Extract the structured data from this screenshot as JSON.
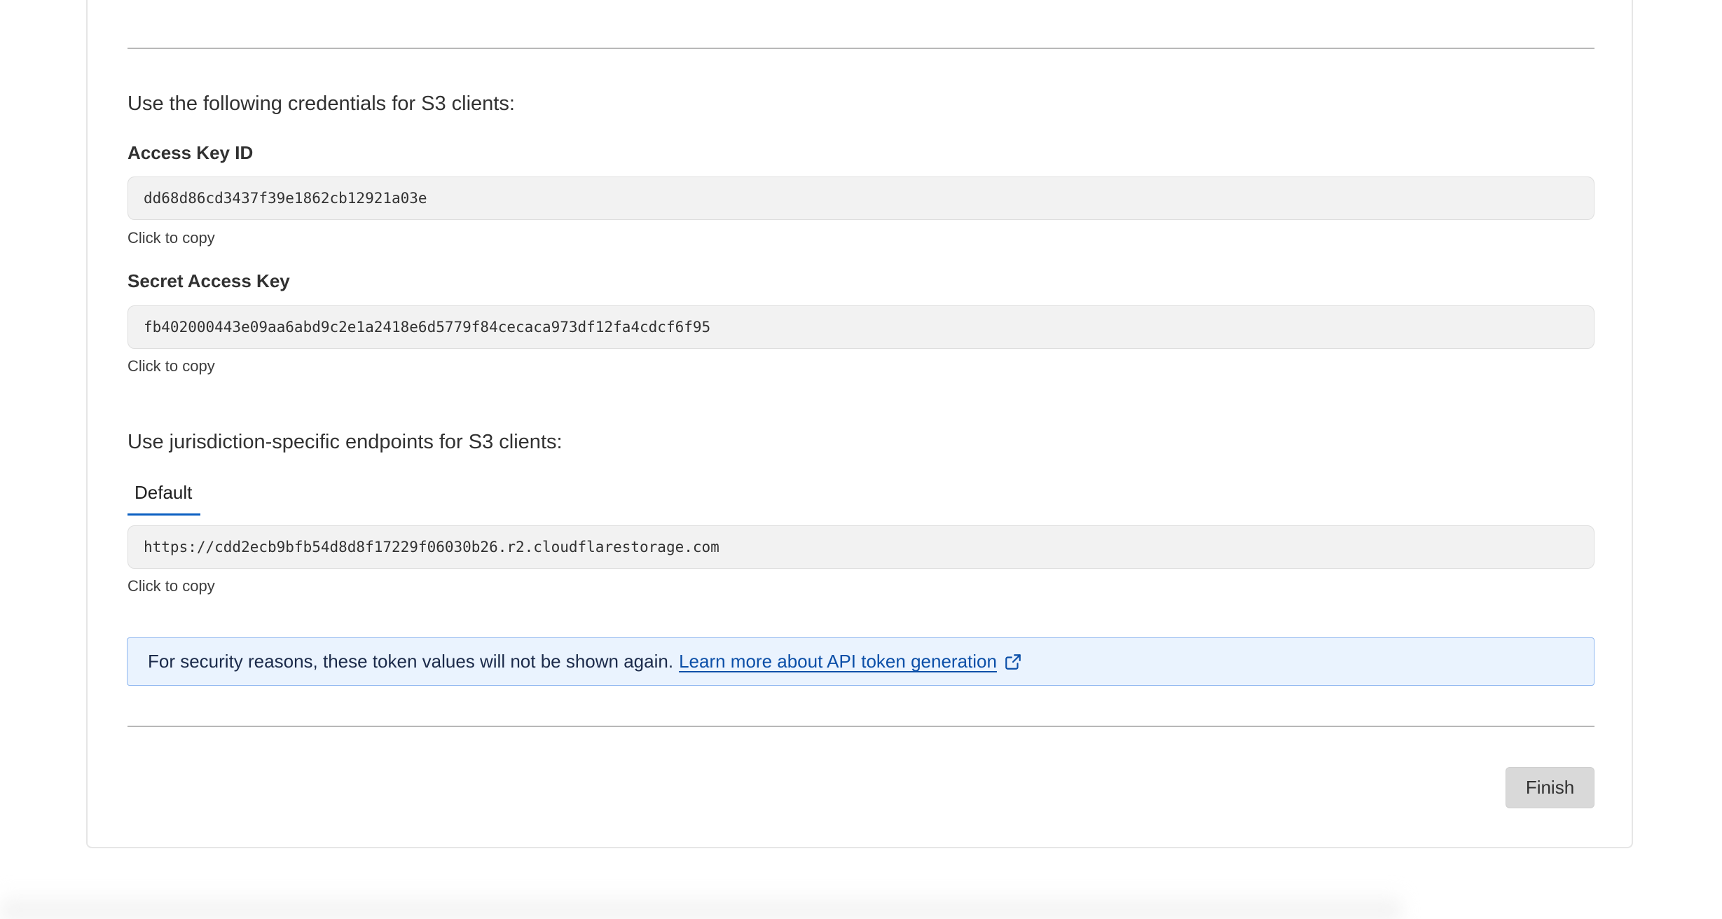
{
  "credentials": {
    "heading": "Use the following credentials for S3 clients:",
    "access_key": {
      "label": "Access Key ID",
      "value": "dd68d86cd3437f39e1862cb12921a03e",
      "hint": "Click to copy"
    },
    "secret_key": {
      "label": "Secret Access Key",
      "value": "fb402000443e09aa6abd9c2e1a2418e6d5779f84cecaca973df12fa4cdcf6f95",
      "hint": "Click to copy"
    }
  },
  "endpoints": {
    "heading": "Use jurisdiction-specific endpoints for S3 clients:",
    "tabs": [
      {
        "label": "Default",
        "active": true
      }
    ],
    "value": "https://cdd2ecb9bfb54d8d8f17229f06030b26.r2.cloudflarestorage.com",
    "hint": "Click to copy"
  },
  "notice": {
    "text": "For security reasons, these token values will not be shown again.",
    "link_text": "Learn more about API token generation",
    "icon": "external-link-icon"
  },
  "footer": {
    "finish_label": "Finish"
  },
  "colors": {
    "accent": "#0b5fc2",
    "link": "#0b4fa8",
    "notice_bg": "#eaf3fe",
    "notice_border": "#8fb7f0",
    "field_bg": "#f2f2f2",
    "button_bg": "#d9d9d9"
  }
}
